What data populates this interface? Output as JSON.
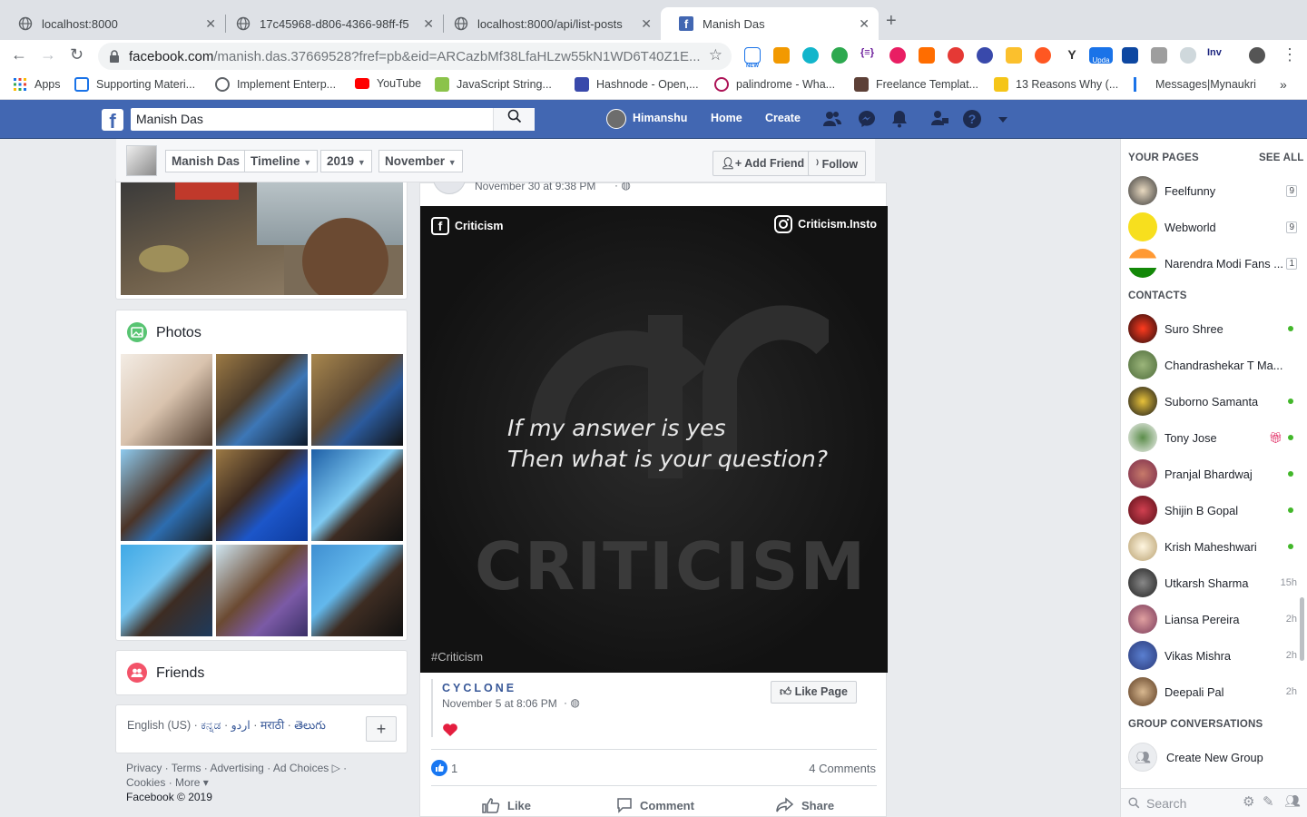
{
  "browser": {
    "tabs": [
      {
        "title": "localhost:8000",
        "active": false
      },
      {
        "title": "17c45968-d806-4366-98ff-f5",
        "active": false
      },
      {
        "title": "localhost:8000/api/list-posts",
        "active": false
      },
      {
        "title": "Manish Das",
        "active": true
      }
    ],
    "url_host": "facebook.com",
    "url_path": "/manish.das.37669528?fref=pb&eid=ARCazbMf38LfaHLzw55kN1WD6T40Z1E...",
    "bookmarks": [
      "Apps",
      "Supporting Materi...",
      "Implement Enterp...",
      "YouTube",
      "JavaScript String...",
      "Hashnode - Open,...",
      "palindrome - Wha...",
      "Freelance Templat...",
      "13 Reasons Why (...",
      "Messages|Mynaukri"
    ],
    "ext_labels": {
      "upda": "Upda",
      "inv": "Inv",
      "new": "NEW"
    }
  },
  "fbbar": {
    "search_value": "Manish Das",
    "user": "Himanshu",
    "home": "Home",
    "create": "Create"
  },
  "profile_bar": {
    "name": "Manish Das",
    "timeline": "Timeline",
    "year": "2019",
    "month": "November",
    "add_friend": "Add Friend",
    "follow": "Follow"
  },
  "left": {
    "photos_title": "Photos",
    "friends_title": "Friends",
    "languages": {
      "current": "English (US)",
      "others": [
        "ಕನ್ನಡ",
        "اردو",
        "मराठी",
        "తెలుగు"
      ]
    },
    "footer_line1": [
      "Privacy",
      "Terms",
      "Advertising",
      "Ad Choices"
    ],
    "footer_line2": [
      "Cookies",
      "More"
    ],
    "copyright": "Facebook © 2019"
  },
  "post": {
    "header_date": "November 30 at 9:38 PM",
    "image_text": {
      "fb_label": "Criticism",
      "ig_label": "Criticism.Insto",
      "quote_line1": "If my answer is yes",
      "quote_line2": "Then what is your question?",
      "brand": "CRITICISM",
      "hashtag": "#Criticism"
    },
    "shared_page": "CYCLONE",
    "shared_date": "November 5 at 8:06 PM",
    "like_page": "Like Page",
    "reactions_count": "1",
    "comments": "4 Comments",
    "actions": {
      "like": "Like",
      "comment": "Comment",
      "share": "Share"
    }
  },
  "right": {
    "your_pages": "YOUR PAGES",
    "see_all": "SEE ALL",
    "pages": [
      {
        "name": "Feelfunny",
        "count": "9"
      },
      {
        "name": "Webworld",
        "count": "9"
      },
      {
        "name": "Narendra Modi Fans ...",
        "count": "1"
      }
    ],
    "contacts_title": "CONTACTS",
    "contacts": [
      {
        "name": "Suro Shree",
        "status": ""
      },
      {
        "name": "Chandrashekar T Ma...",
        "status": ""
      },
      {
        "name": "Suborno Samanta",
        "status": ""
      },
      {
        "name": "Tony Jose",
        "status": ""
      },
      {
        "name": "Pranjal Bhardwaj",
        "status": ""
      },
      {
        "name": "Shijin B Gopal",
        "status": ""
      },
      {
        "name": "Krish Maheshwari",
        "status": ""
      },
      {
        "name": "Utkarsh Sharma",
        "status": "15h"
      },
      {
        "name": "Liansa Pereira",
        "status": "2h"
      },
      {
        "name": "Vikas Mishra",
        "status": "2h"
      },
      {
        "name": "Deepali Pal",
        "status": "2h"
      }
    ],
    "group_title": "GROUP CONVERSATIONS",
    "create_group": "Create New Group",
    "search_placeholder": "Search"
  },
  "colors": {
    "fb_blue": "#4267b2",
    "online": "#42b72a",
    "heart": "#e41e3f"
  }
}
